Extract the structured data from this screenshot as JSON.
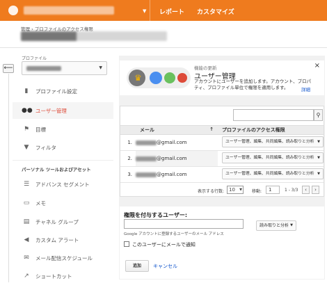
{
  "topbar": {
    "nav_report": "レポート",
    "nav_customize": "カスタマイズ"
  },
  "header": {
    "breadcrumb": "管理 › プロファイルのアクセス権限"
  },
  "sidebar": {
    "profile_label": "プロファイル",
    "items": [
      {
        "label": "プロファイル設定",
        "icon": "document-icon"
      },
      {
        "label": "ユーザー管理",
        "icon": "users-icon",
        "active": true
      },
      {
        "label": "目標",
        "icon": "flag-icon"
      },
      {
        "label": "フィルタ",
        "icon": "filter-icon"
      }
    ],
    "section_title": "パーソナル ツールおよびアセット",
    "tools": [
      {
        "label": "アドバンス セグメント",
        "icon": "segment-icon"
      },
      {
        "label": "メモ",
        "icon": "note-icon"
      },
      {
        "label": "チャネル グループ",
        "icon": "channel-icon"
      },
      {
        "label": "カスタム アラート",
        "icon": "megaphone-icon"
      },
      {
        "label": "メール配信スケジュール",
        "icon": "mail-schedule-icon"
      },
      {
        "label": "ショートカット",
        "icon": "shortcut-icon"
      }
    ]
  },
  "notice": {
    "small": "機能の更新",
    "title": "ユーザー管理",
    "desc": "アカウントにユーザーを追加します。アカウント、プロパティ、プロファイル単位で権限を適用します。",
    "detail": "詳細",
    "close": "×"
  },
  "table": {
    "col_email": "メール",
    "col_perm": "プロファイルのアクセス権限",
    "rows": [
      {
        "num": "1.",
        "email": "@gmail.com",
        "perm": "ユーザー管理、編集、共同編集、読み取りと分析"
      },
      {
        "num": "2.",
        "email": "@gmail.com",
        "perm": "ユーザー管理、編集、共同編集、読み取りと分析"
      },
      {
        "num": "3.",
        "email": "@gmail.com",
        "perm": "ユーザー管理、編集、共同編集、読み取りと分析"
      }
    ],
    "rows_label": "表示する行数:",
    "rows_value": "10",
    "goto_label": "移動:",
    "goto_value": "1",
    "range": "1 - 3/3"
  },
  "add": {
    "header": "権限を付与するユーザー:",
    "hint": "Google アカウントに登録するユーザーのメール アドレス",
    "perm": "読み取りと分析",
    "notify": "このユーザーにメールで通知",
    "add_btn": "追加",
    "cancel": "キャンセル"
  }
}
